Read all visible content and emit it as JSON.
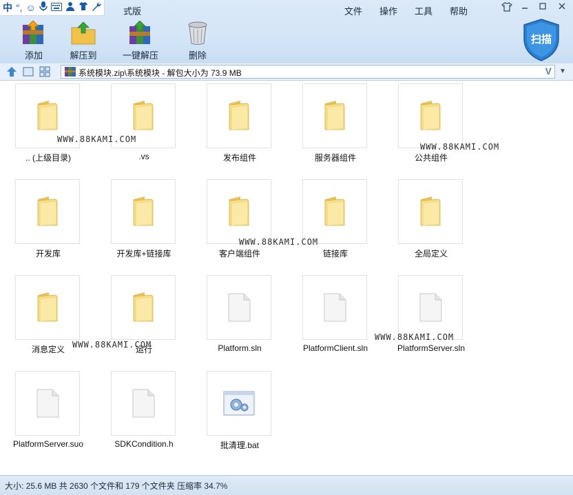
{
  "ime": {
    "lang": "中",
    "punct": "°,"
  },
  "app": {
    "title": "式版"
  },
  "menu": {
    "file": "文件",
    "operate": "操作",
    "tools": "工具",
    "help": "帮助"
  },
  "toolbar": {
    "add": "添加",
    "extract": "解压到",
    "oneclick": "一键解压",
    "delete": "删除"
  },
  "scan": {
    "label": "扫描"
  },
  "address": {
    "path": "系统模块.zip\\系统模块 - 解包大小为 73.9 MB",
    "v_label": "V"
  },
  "files": [
    {
      "name": ".. (上级目录)",
      "type": "folder"
    },
    {
      "name": ".vs",
      "type": "folder"
    },
    {
      "name": "发布组件",
      "type": "folder"
    },
    {
      "name": "服务器组件",
      "type": "folder"
    },
    {
      "name": "公共组件",
      "type": "folder"
    },
    {
      "name": "开发库",
      "type": "folder"
    },
    {
      "name": "开发库+链接库",
      "type": "folder"
    },
    {
      "name": "客户端组件",
      "type": "folder"
    },
    {
      "name": "链接库",
      "type": "folder"
    },
    {
      "name": "全局定义",
      "type": "folder"
    },
    {
      "name": "消息定义",
      "type": "folder"
    },
    {
      "name": "运行",
      "type": "folder"
    },
    {
      "name": "Platform.sln",
      "type": "file"
    },
    {
      "name": "PlatformClient.sln",
      "type": "file"
    },
    {
      "name": "PlatformServer.sln",
      "type": "file"
    },
    {
      "name": "PlatformServer.suo",
      "type": "file"
    },
    {
      "name": "SDKCondition.h",
      "type": "file"
    },
    {
      "name": "批清理.bat",
      "type": "bat"
    }
  ],
  "watermark": "WWW.88KAMI.COM",
  "status": {
    "text": "大小: 25.6 MB 共 2630 个文件和 179 个文件夹 压缩率 34.7%"
  }
}
